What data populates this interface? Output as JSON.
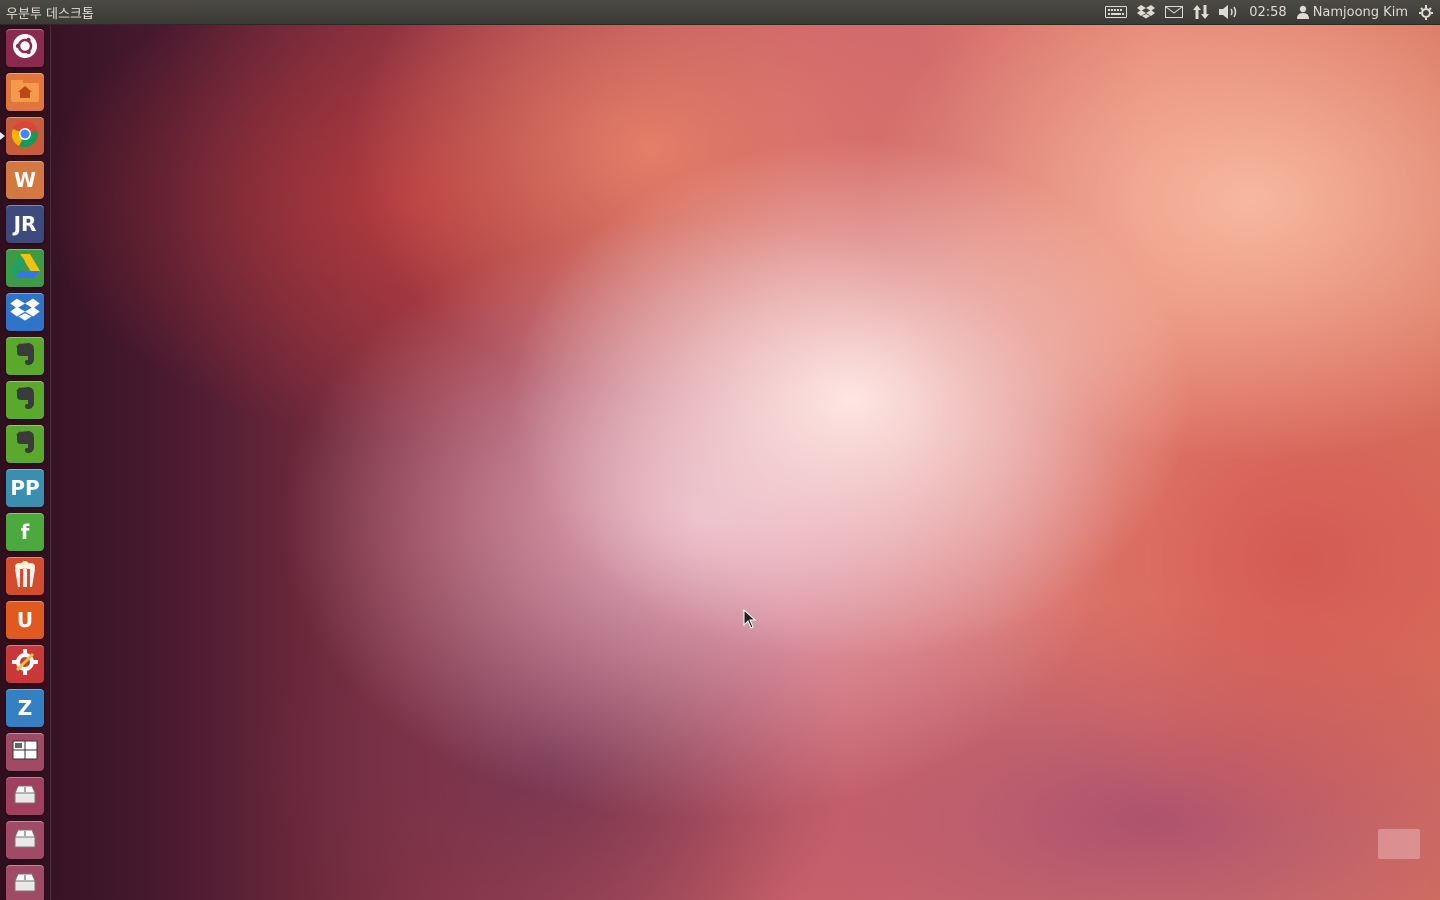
{
  "panel": {
    "title": "우분투 데스크톱",
    "clock": "02:58",
    "user_name": "Namjoong Kim"
  },
  "indicators": [
    "keyboard-icon",
    "dropbox-icon",
    "mail-icon",
    "network-icon",
    "volume-icon",
    "user-icon",
    "gear-icon"
  ],
  "launcher": {
    "items": [
      {
        "name": "dash-home",
        "icon": "ubuntu-logo-icon",
        "color": "#8a2a4e",
        "glyph": ""
      },
      {
        "name": "files",
        "icon": "home-folder-icon",
        "color": "#e0763a",
        "glyph": ""
      },
      {
        "name": "chrome",
        "icon": "chrome-icon",
        "color": "#c85c3a",
        "glyph": ""
      },
      {
        "name": "wps",
        "icon": "wps-icon",
        "color": "#d27840",
        "glyph": "W"
      },
      {
        "name": "jr",
        "icon": "jr-icon",
        "color": "#3c4a7e",
        "glyph": "JR"
      },
      {
        "name": "drive",
        "icon": "google-drive-icon",
        "color": "#3e9a48",
        "glyph": ""
      },
      {
        "name": "dropbox",
        "icon": "dropbox-icon",
        "color": "#2f74c8",
        "glyph": ""
      },
      {
        "name": "evernote-1",
        "icon": "evernote-icon",
        "color": "#5aa82c",
        "glyph": ""
      },
      {
        "name": "evernote-2",
        "icon": "evernote-icon",
        "color": "#5aa82c",
        "glyph": ""
      },
      {
        "name": "evernote-3",
        "icon": "evernote-icon",
        "color": "#5aa82c",
        "glyph": ""
      },
      {
        "name": "pp",
        "icon": "pp-icon",
        "color": "#3a8fb0",
        "glyph": "PP"
      },
      {
        "name": "feedly",
        "icon": "feedly-icon",
        "color": "#4caa3c",
        "glyph": "f"
      },
      {
        "name": "popcorn",
        "icon": "popcorn-icon",
        "color": "#d44c2c",
        "glyph": ""
      },
      {
        "name": "ubuntu-one",
        "icon": "ubuntu-one-icon",
        "color": "#e05a20",
        "glyph": "U"
      },
      {
        "name": "settings",
        "icon": "settings-icon",
        "color": "#c83838",
        "glyph": ""
      },
      {
        "name": "zoho",
        "icon": "zoho-icon",
        "color": "#3380c4",
        "glyph": "Z"
      },
      {
        "name": "workspaces",
        "icon": "workspace-switcher-icon",
        "color": "#a04a66",
        "glyph": ""
      },
      {
        "name": "usb",
        "icon": "usb-drive-icon",
        "color": "#a0405e",
        "glyph": ""
      },
      {
        "name": "drive-1",
        "icon": "usb-drive-icon",
        "color": "#a04a66",
        "glyph": ""
      },
      {
        "name": "drive-2",
        "icon": "usb-drive-icon",
        "color": "#a04a66",
        "glyph": ""
      }
    ]
  }
}
